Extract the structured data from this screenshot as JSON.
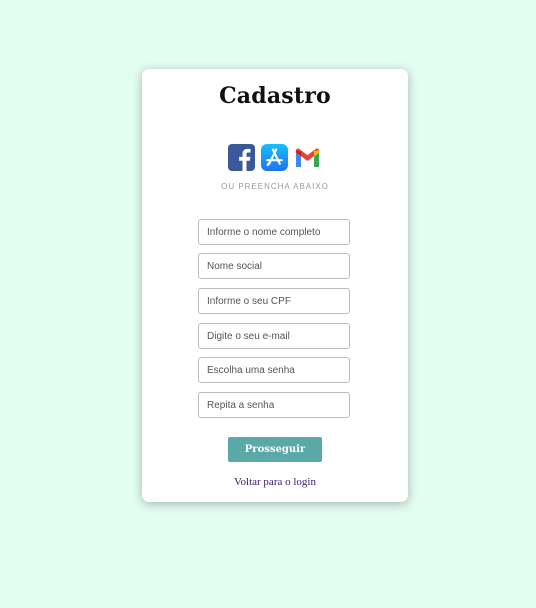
{
  "form": {
    "title": "Cadastro",
    "divider_text": "OU PREENCHA ABAIXO",
    "social_icons": [
      "facebook-icon",
      "app-store-icon",
      "gmail-icon"
    ],
    "fields": [
      {
        "placeholder": "Informe o nome completo"
      },
      {
        "placeholder": "Nome social"
      },
      {
        "placeholder": "Informe o seu CPF"
      },
      {
        "placeholder": "Digite o seu e-mail"
      },
      {
        "placeholder": "Escolha uma senha"
      },
      {
        "placeholder": "Repita a senha"
      }
    ],
    "submit_label": "Prosseguir",
    "back_link": "Voltar para o login"
  },
  "colors": {
    "background": "#e2fdf2",
    "card": "#ffffff",
    "accent": "#5aa9a8",
    "link": "#3a1870",
    "facebook": "#3b5998",
    "app_store": "#1a8cff"
  }
}
